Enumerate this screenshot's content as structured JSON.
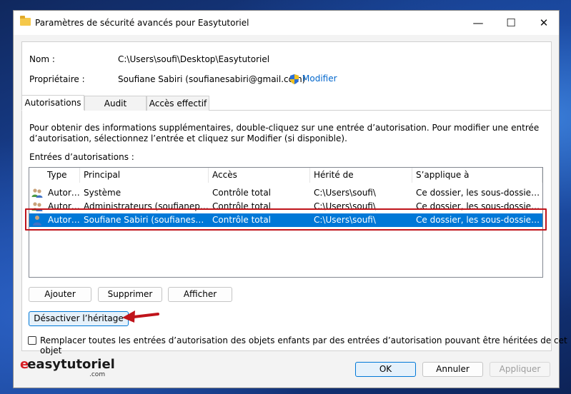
{
  "window": {
    "title": "Paramètres de sécurité avancés pour Easytutoriel",
    "controls": {
      "minimize": "—",
      "maximize": "☐",
      "close": "✕"
    }
  },
  "info": {
    "name_label": "Nom :",
    "name_value": "C:\\Users\\soufi\\Desktop\\Easytutoriel",
    "owner_label": "Propriétaire :",
    "owner_value": "Soufiane Sabiri (soufianesabiri@gmail.com)",
    "modify_link": "Modifier"
  },
  "tabs": [
    {
      "label": "Autorisations",
      "active": true
    },
    {
      "label": "Audit",
      "active": false
    },
    {
      "label": "Accès effectif",
      "active": false
    }
  ],
  "description": "Pour obtenir des informations supplémentaires, double-cliquez sur une entrée d’autorisation. Pour modifier une entrée d’autorisation, sélectionnez l’entrée et cliquez sur Modifier (si disponible).",
  "entries_label": "Entrées d’autorisations :",
  "table": {
    "columns": [
      "Type",
      "Principal",
      "Accès",
      "Hérité de",
      "S’applique à"
    ],
    "rows": [
      {
        "type": "Autoriser",
        "principal": "Système",
        "access": "Contrôle total",
        "inherited": "C:\\Users\\soufi\\",
        "applies": "Ce dossier, les sous-dossiers et les fichiers",
        "selected": false
      },
      {
        "type": "Autoriser",
        "principal": "Administrateurs (soufianepc\\Administrateurs)",
        "access": "Contrôle total",
        "inherited": "C:\\Users\\soufi\\",
        "applies": "Ce dossier, les sous-dossiers et les fichiers",
        "selected": false
      },
      {
        "type": "Autoriser",
        "principal": "Soufiane Sabiri (soufianesabiri@gmail.com)",
        "access": "Contrôle total",
        "inherited": "C:\\Users\\soufi\\",
        "applies": "Ce dossier, les sous-dossiers et les fichiers",
        "selected": true
      }
    ]
  },
  "buttons": {
    "add": "Ajouter",
    "remove": "Supprimer",
    "view": "Afficher",
    "disable_inheritance": "Désactiver l’héritage",
    "ok": "OK",
    "cancel": "Annuler",
    "apply": "Appliquer"
  },
  "replace_checkbox": "Remplacer toutes les entrées d’autorisation des objets enfants par des entrées d’autorisation pouvant être héritées de cet objet",
  "logo": {
    "text": "easytutoriel",
    "sub": ".com"
  },
  "colors": {
    "selection": "#0078d7",
    "highlight": "#c0141b",
    "link": "#0066cc"
  }
}
